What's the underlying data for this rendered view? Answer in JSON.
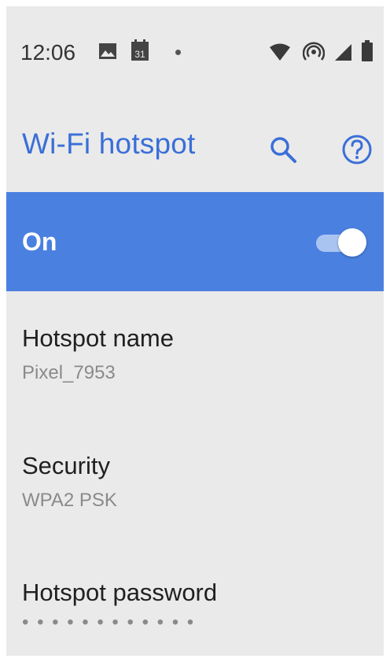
{
  "status_bar": {
    "time": "12:06",
    "calendar_day": "31",
    "icons": [
      "image-icon",
      "calendar-icon",
      "notification-dot-icon",
      "wifi-icon",
      "hotspot-icon",
      "signal-icon",
      "battery-icon"
    ]
  },
  "app_bar": {
    "title": "Wi-Fi hotspot",
    "actions": [
      "search-icon",
      "help-icon"
    ]
  },
  "master_switch": {
    "label": "On",
    "checked": true
  },
  "settings": {
    "hotspot_name": {
      "title": "Hotspot name",
      "summary": "Pixel_7953"
    },
    "security": {
      "title": "Security",
      "summary": "WPA2 PSK"
    },
    "hotspot_password": {
      "title": "Hotspot password",
      "summary": "• • • • • • • • • • • •"
    }
  },
  "colors": {
    "accent": "#3a6fd8",
    "switch_bar": "#4a80e0",
    "background": "#eaeaea",
    "summary_text": "#8a8a8a"
  }
}
